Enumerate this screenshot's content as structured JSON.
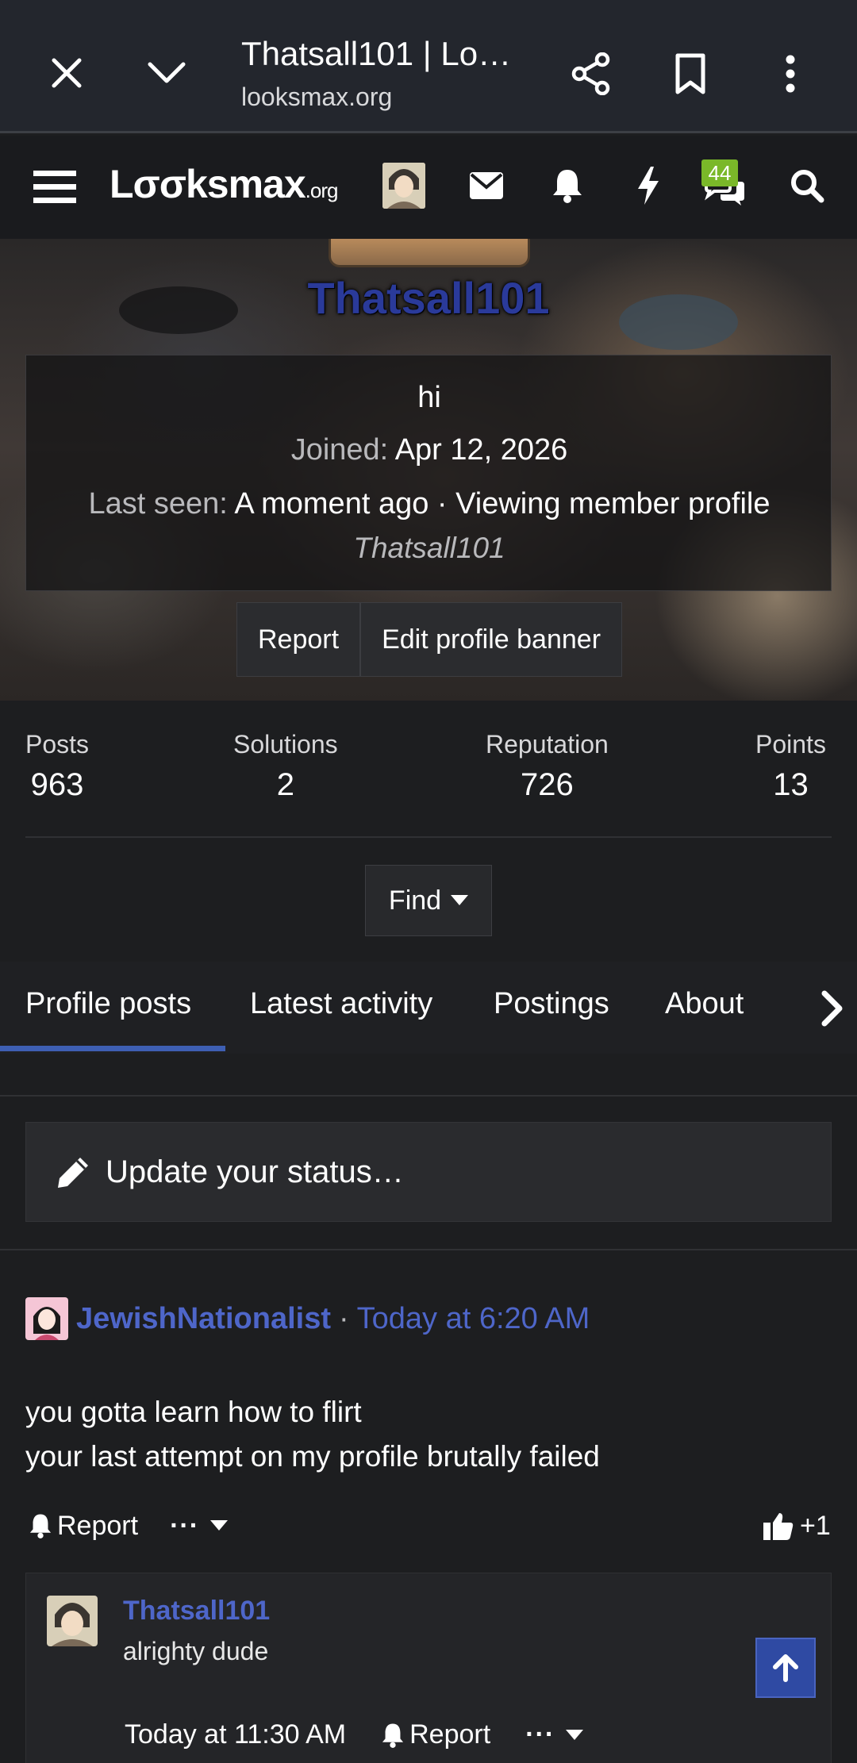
{
  "browser": {
    "tab_title": "Thatsall101 | Lo…",
    "url": "looksmax.org"
  },
  "site": {
    "logo_main": "Lσσksmax",
    "logo_suffix": ".org",
    "conversations_badge": "44"
  },
  "profile": {
    "username": "Thatsall101",
    "status": "hi",
    "joined_label": "Joined:",
    "joined_value": "Apr 12, 2026",
    "last_seen_label": "Last seen:",
    "last_seen_value": "A moment ago · Viewing member profile",
    "last_seen_target": "Thatsall101",
    "report_label": "Report",
    "edit_banner_label": "Edit profile banner"
  },
  "stats": [
    {
      "label": "Posts",
      "value": "963"
    },
    {
      "label": "Solutions",
      "value": "2"
    },
    {
      "label": "Reputation",
      "value": "726"
    },
    {
      "label": "Points",
      "value": "13"
    }
  ],
  "find_label": "Find",
  "tabs": [
    {
      "label": "Profile posts",
      "active": true
    },
    {
      "label": "Latest activity",
      "active": false
    },
    {
      "label": "Postings",
      "active": false
    },
    {
      "label": "About",
      "active": false
    }
  ],
  "status_prompt": "Update your status…",
  "post": {
    "author": "JewishNationalist",
    "separator": "·",
    "time": "Today at 6:20 AM",
    "line1": "you gotta learn how to flirt",
    "line2": "your last attempt on my profile brutally failed",
    "report_label": "Report",
    "more_label": "···",
    "reaction": "+1"
  },
  "reply": {
    "author": "Thatsall101",
    "text": "alrighty dude",
    "time": "Today at 11:30 AM",
    "report_label": "Report",
    "more_label": "···"
  },
  "colors": {
    "accent": "#4e66c9",
    "badge": "#7ab829",
    "tab_active": "#3e5fb3"
  }
}
